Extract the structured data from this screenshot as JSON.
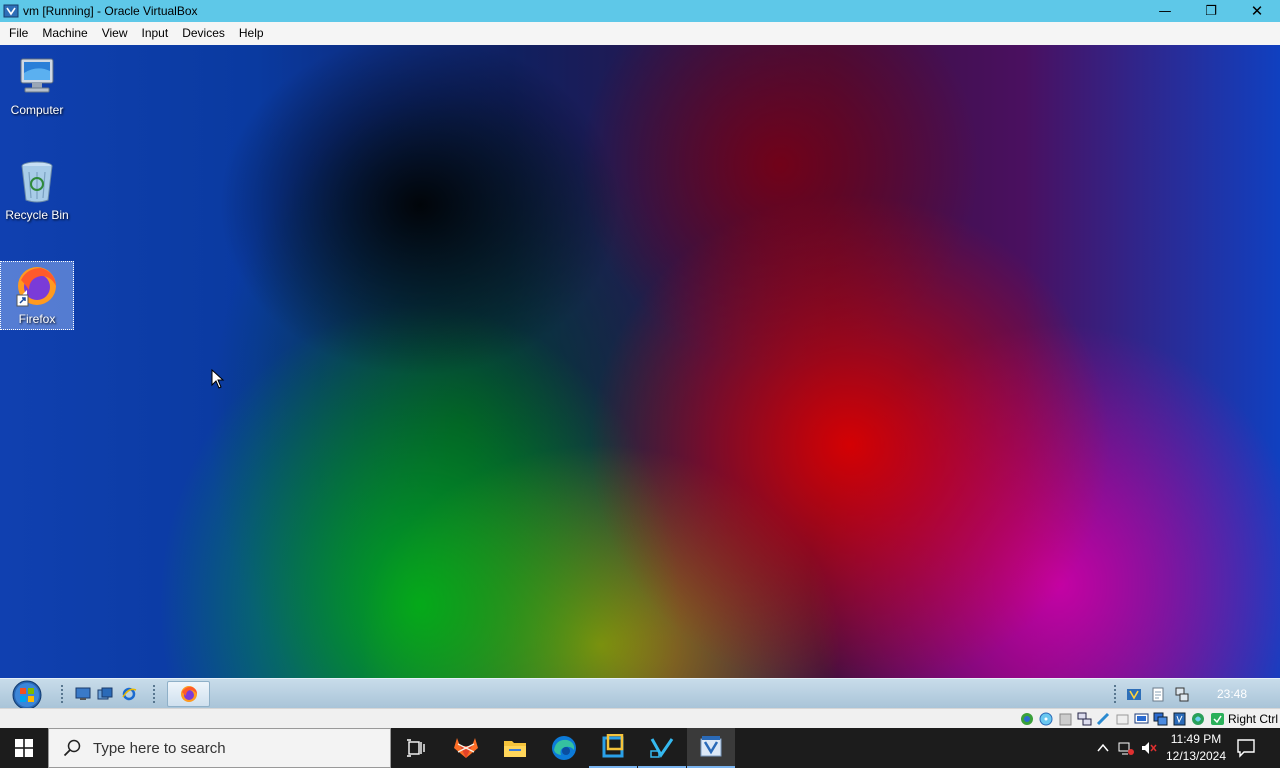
{
  "window": {
    "title": "vm [Running] - Oracle VirtualBox",
    "minimize_glyph": "—",
    "restore_glyph": "❐",
    "close_glyph": "✕"
  },
  "menu": [
    "File",
    "Machine",
    "View",
    "Input",
    "Devices",
    "Help"
  ],
  "desktop": {
    "icons": [
      {
        "label": "Computer",
        "icon": "computer-icon"
      },
      {
        "label": "Recycle Bin",
        "icon": "recycle-bin-icon"
      },
      {
        "label": "Firefox",
        "icon": "firefox-icon",
        "selected": true
      }
    ]
  },
  "guest_taskbar": {
    "clock": "23:48",
    "quick_launch": [
      "show-desktop-icon",
      "switch-windows-icon",
      "internet-explorer-icon"
    ],
    "tasks": [
      "firefox-icon"
    ],
    "tray": [
      "virtualbox-guest-icon",
      "document-icon",
      "network-icon"
    ]
  },
  "vbox_status": {
    "host_key": "Right Ctrl",
    "indicators": [
      "hard-disk-icon",
      "optical-drive-icon",
      "floppy-icon",
      "network-adapter-icon",
      "usb-icon",
      "shared-folders-icon",
      "display-icon",
      "video-capture-icon",
      "cpu-icon",
      "mouse-integration-icon",
      "keyboard-icon",
      "host-key-icon"
    ]
  },
  "host_taskbar": {
    "search_placeholder": "Type here to search",
    "apps": [
      "task-view-icon",
      "gitlab-icon",
      "file-explorer-icon",
      "edge-icon",
      "virtualbox-manager-icon",
      "vscode-icon",
      "virtualbox-vm-icon"
    ],
    "time": "11:49 PM",
    "date": "12/13/2024"
  },
  "colors": {
    "titlebar": "#5ec8e8",
    "host_taskbar": "#1c1c1c",
    "guest_taskbar": "#b8d0e2"
  }
}
